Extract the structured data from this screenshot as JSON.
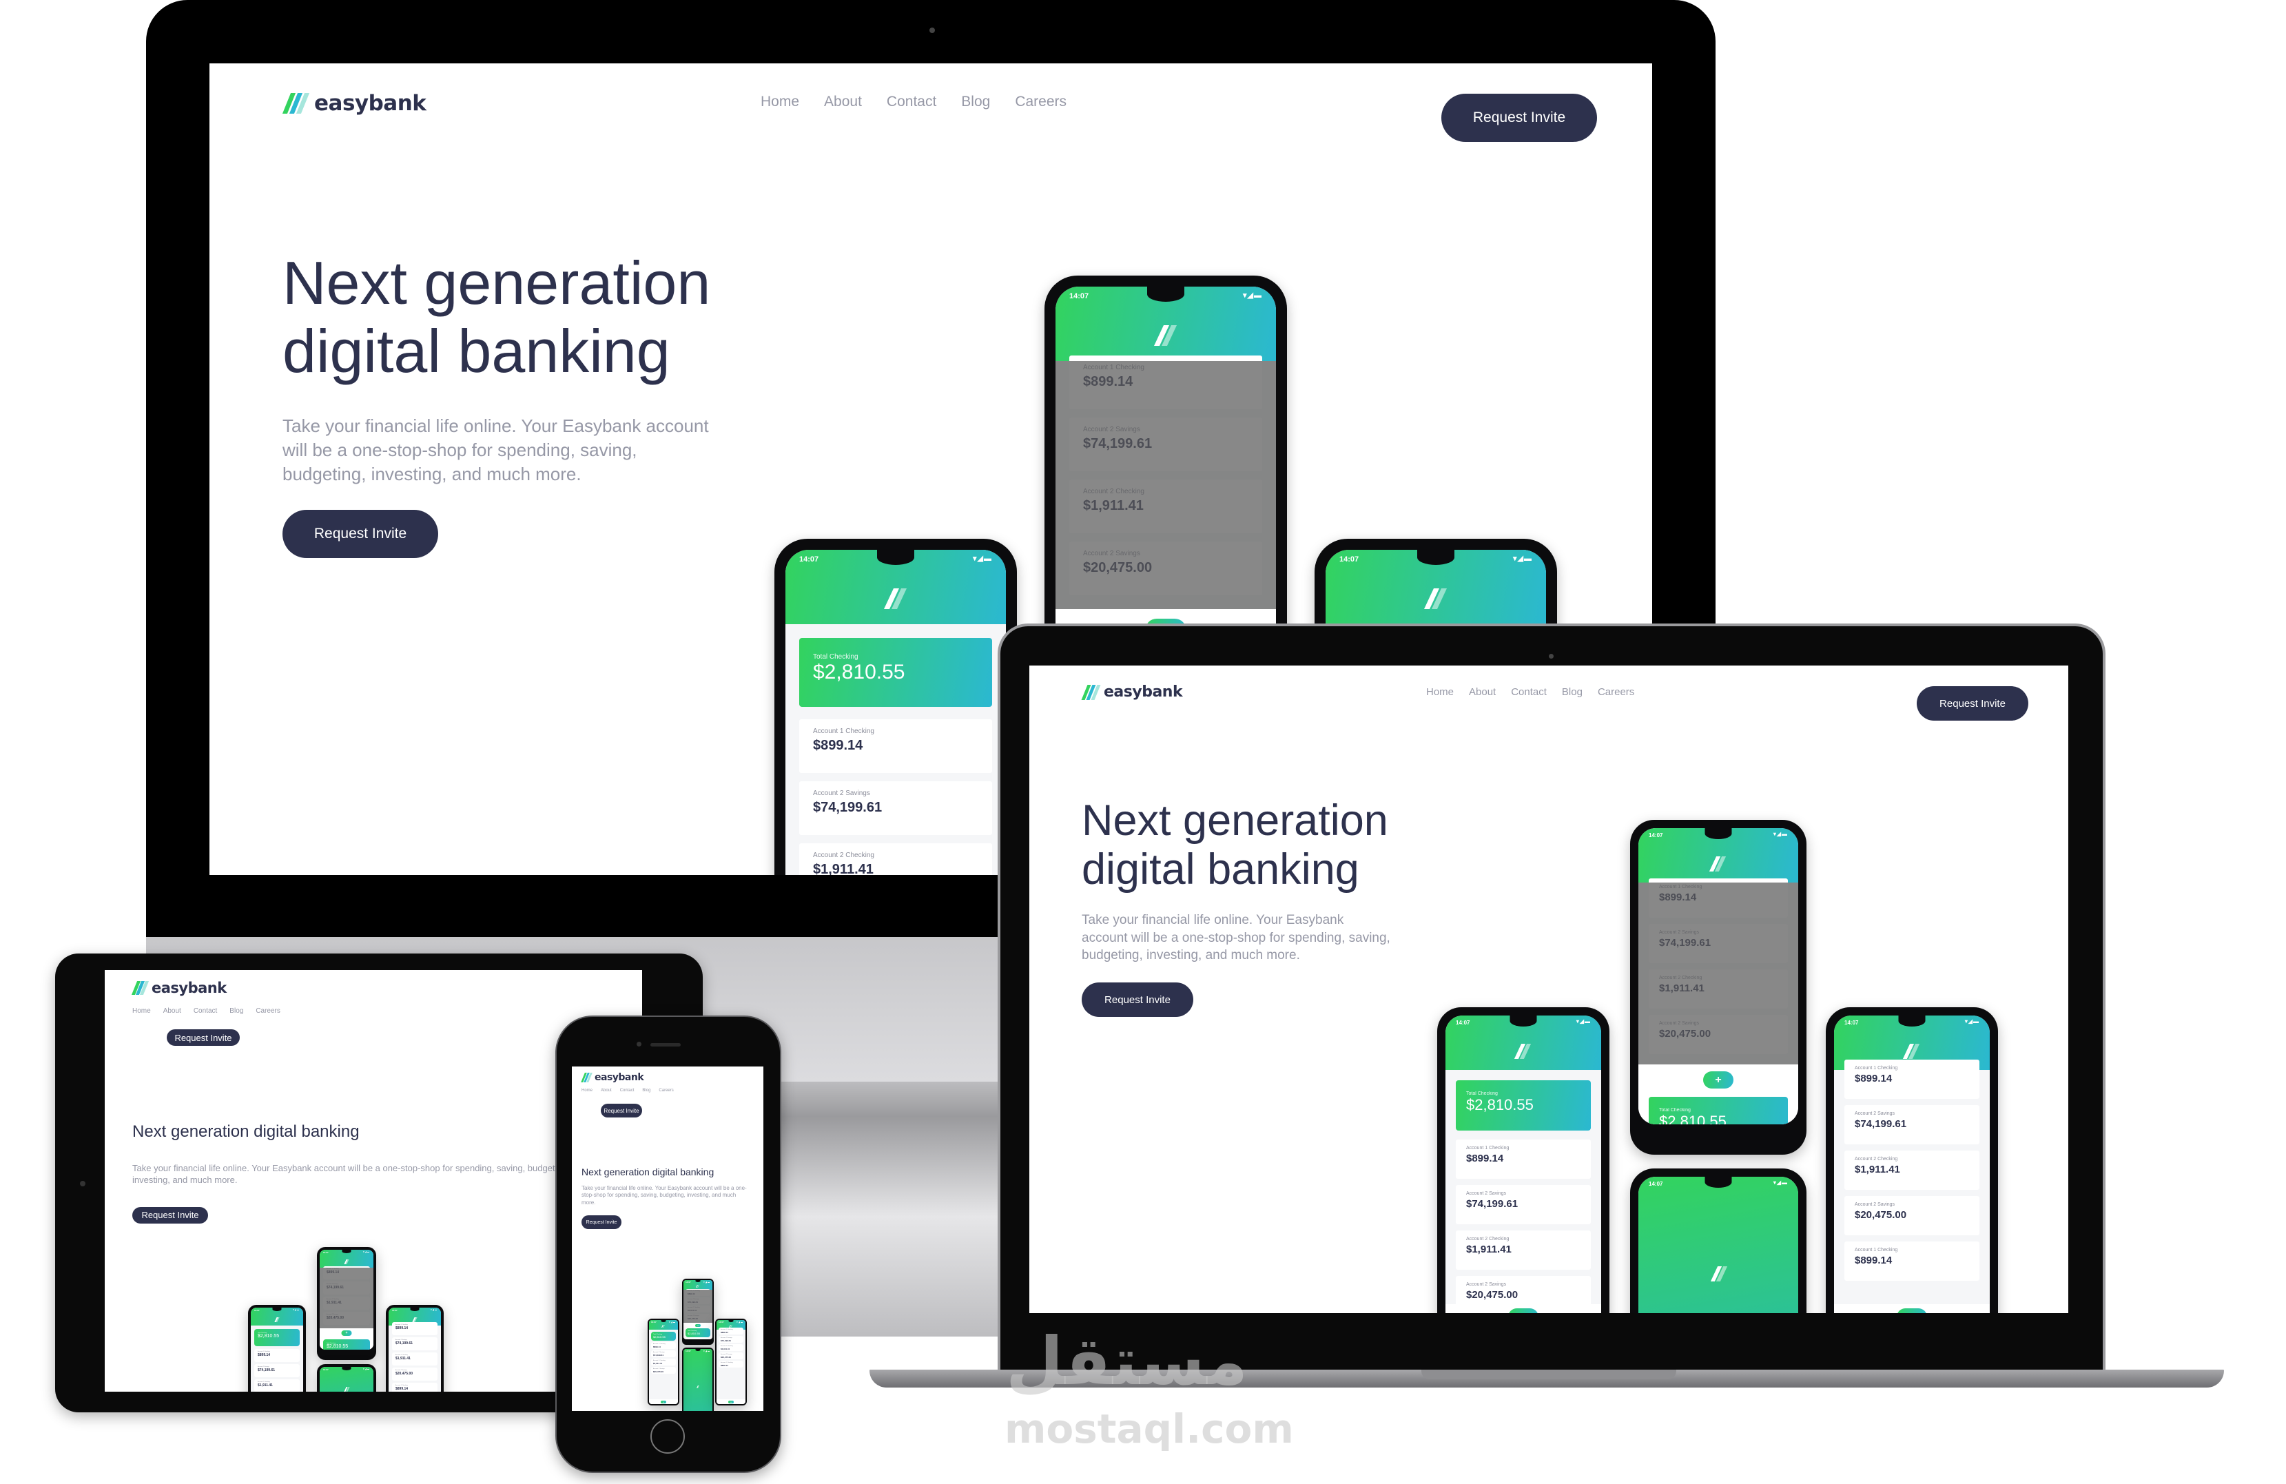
{
  "brand": {
    "name": "easybank",
    "logo_icon": "slash-stripes-logo-icon",
    "primary_color": "#2d314d",
    "accent_gradient": [
      "#33d35e",
      "#2bb8d1"
    ],
    "muted_text_color": "#9698a6"
  },
  "nav": {
    "items": [
      {
        "label": "Home"
      },
      {
        "label": "About"
      },
      {
        "label": "Contact"
      },
      {
        "label": "Blog"
      },
      {
        "label": "Careers"
      }
    ]
  },
  "header": {
    "cta_label": "Request Invite"
  },
  "hero": {
    "title_line1": "Next generation",
    "title_line2": "digital banking",
    "title_full": "Next generation digital banking",
    "description": "Take your financial life online. Your Easybank account will be a one-stop-shop for spending, saving, budgeting, investing, and much more.",
    "cta_label": "Request Invite"
  },
  "phone_app": {
    "status_time": "14:07",
    "status_icons": "wifi-signal-battery-icons",
    "status_icons_glyph": "▾◢▬",
    "fab_icon": "plus-icon",
    "fab_glyph": "+",
    "total": {
      "label": "Total Checking",
      "amount": "$2,810.55"
    },
    "accounts": [
      {
        "label": "Account 1 Checking",
        "amount": "$899.14"
      },
      {
        "label": "Account 2 Savings",
        "amount": "$74,199.61"
      },
      {
        "label": "Account 2 Checking",
        "amount": "$1,911.41"
      },
      {
        "label": "Account 2 Savings",
        "amount": "$20,475.00"
      },
      {
        "label": "Account 1 Checking",
        "amount": "$899.14"
      }
    ]
  },
  "devices": [
    "desktop-monitor",
    "laptop",
    "tablet",
    "smartphone"
  ],
  "watermark": {
    "arabic": "مستقل",
    "latin": "mostaql.com"
  }
}
